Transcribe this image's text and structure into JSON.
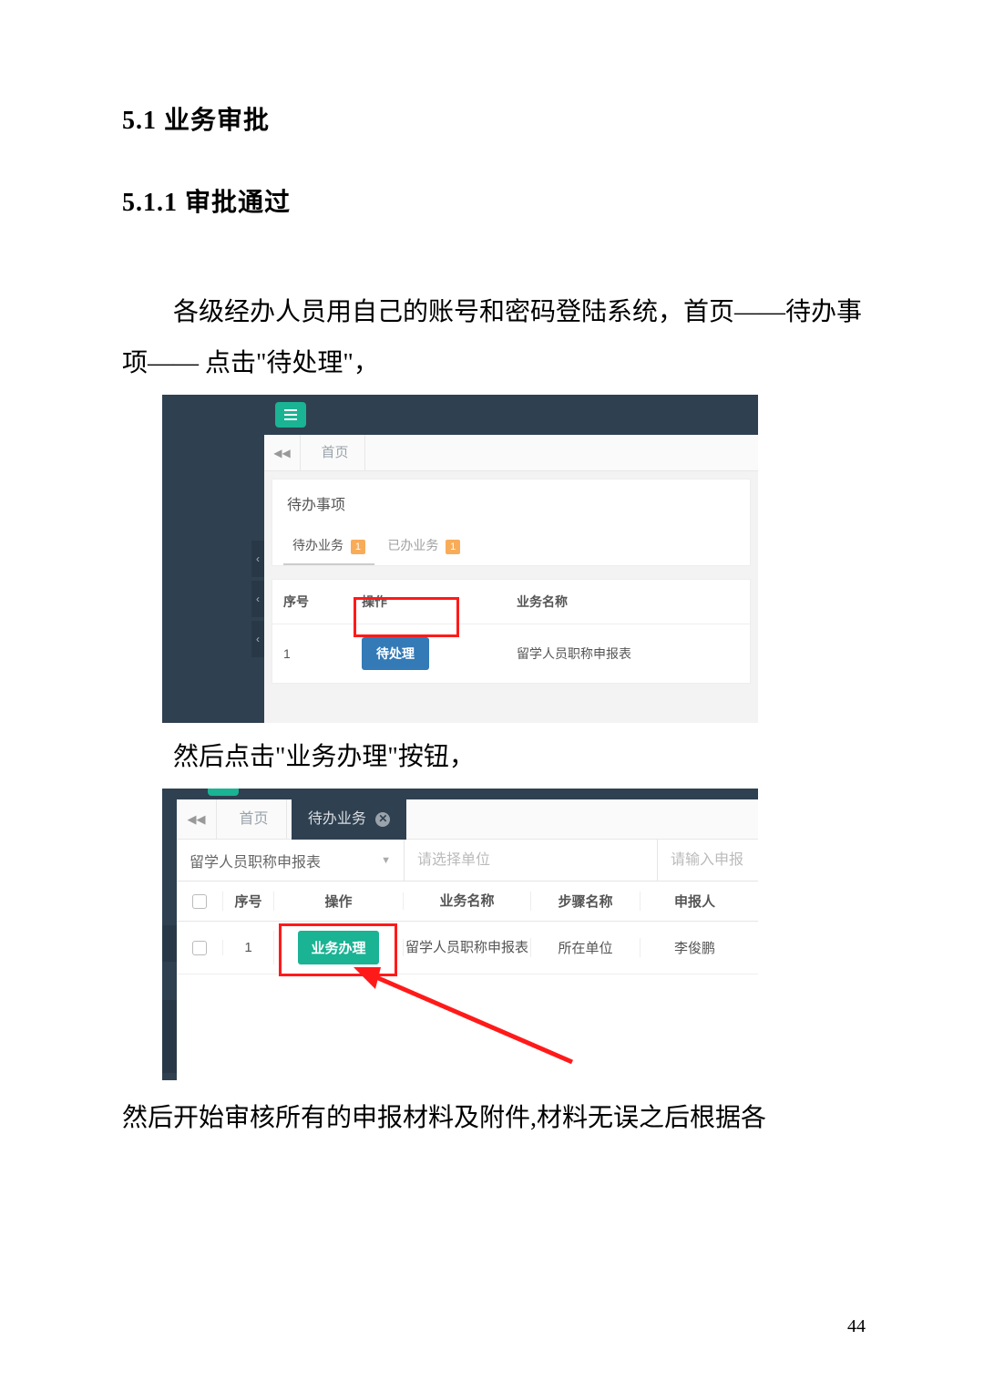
{
  "doc": {
    "h1": "5.1 业务审批",
    "h2": "5.1.1 审批通过",
    "p1": "各级经办人员用自己的账号和密码登陆系统，首页——待办事项—— 点击\"待处理\"，",
    "p2": "然后点击\"业务办理\"按钮，",
    "p3": "然后开始审核所有的申报材料及附件,材料无误之后根据各",
    "page": "44"
  },
  "s1": {
    "home_tab": "首页",
    "back_icon": "◀◀",
    "panel_title": "待办事项",
    "subtab1": "待办业务",
    "subtab1_badge": "1",
    "subtab2": "已办业务",
    "subtab2_badge": "1",
    "col_seq": "序号",
    "col_op": "操作",
    "col_name": "业务名称",
    "row1_seq": "1",
    "row1_btn": "待处理",
    "row1_name": "留学人员职称申报表",
    "chev": "‹"
  },
  "s2": {
    "back_icon": "◀◀",
    "home_tab": "首页",
    "active_tab": "待办业务",
    "filter_select": "留学人员职称申报表",
    "filter_unit_ph": "请选择单位",
    "filter_name_ph": "请输入申报",
    "col_seq": "序号",
    "col_op": "操作",
    "col_bizname": "业务名称",
    "col_stepname": "步骤名称",
    "col_applicant": "申报人",
    "row1_seq": "1",
    "row1_btn": "业务办理",
    "row1_bizname": "留学人员职称申报表",
    "row1_stepname": "所在单位",
    "row1_applicant": "李俊鹏"
  }
}
